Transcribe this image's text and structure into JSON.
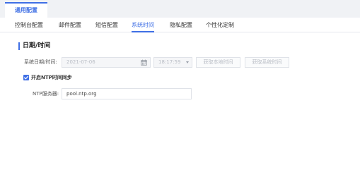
{
  "main_tab": {
    "label": "通用配置"
  },
  "subtabs": [
    {
      "label": "控制台配置",
      "active": false
    },
    {
      "label": "邮件配置",
      "active": false
    },
    {
      "label": "短信配置",
      "active": false
    },
    {
      "label": "系统时间",
      "active": true
    },
    {
      "label": "隐私配置",
      "active": false
    },
    {
      "label": "个性化定制",
      "active": false
    }
  ],
  "section": {
    "title": "日期/时间"
  },
  "datetime": {
    "label": "系统日期/时间:",
    "date_value": "2021-07-06",
    "time_value": "18:17:59",
    "get_local_button": "获取本地时间",
    "get_system_button": "获取系统时间"
  },
  "ntp": {
    "checkbox_label": "开启NTP时间同步",
    "checked": true,
    "server_label": "NTP服务器:",
    "server_value": "pool.ntp.org"
  },
  "colors": {
    "accent": "#3f6fe5"
  },
  "icons": {
    "calendar": "calendar-icon",
    "dropdown": "chevron-down-icon",
    "check": "check-icon"
  }
}
